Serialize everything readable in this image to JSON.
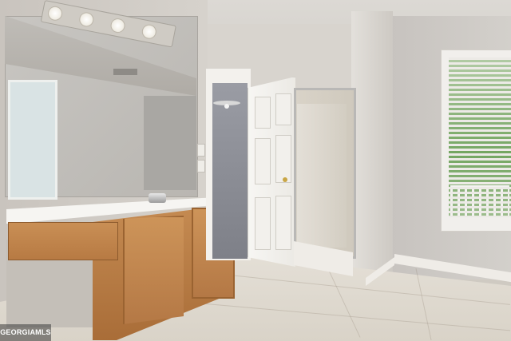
{
  "photo": {
    "subject": "bathroom-interior"
  },
  "watermark": {
    "text": "GEORGIAMLS"
  }
}
